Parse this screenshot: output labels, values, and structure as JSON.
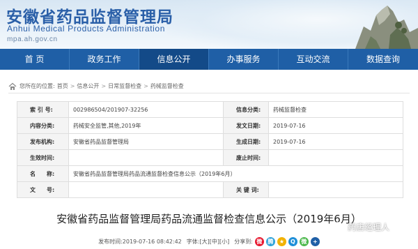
{
  "header": {
    "title": "安徽省药品监督管理局",
    "subtitle": "Anhui Medical Products Administration",
    "url": "mpa.ah.gov.cn"
  },
  "nav": {
    "items": [
      {
        "label": "首 页"
      },
      {
        "label": "政务工作"
      },
      {
        "label": "信息公开"
      },
      {
        "label": "办事服务"
      },
      {
        "label": "互动交流"
      },
      {
        "label": "数据查询"
      }
    ],
    "active_index": 2
  },
  "breadcrumb": {
    "prefix": "您所在的位置:",
    "items": [
      "首页",
      "信息公开",
      "日常监督检查",
      "药械监督检查"
    ],
    "separator": ">"
  },
  "meta": {
    "rows": [
      {
        "l1": "索 引 号:",
        "v1": "002986504/201907-32256",
        "l2": "信息分类:",
        "v2": "药械监督检查"
      },
      {
        "l1": "内容分类:",
        "v1": "药械安全监管,其他,2019年",
        "l2": "发文日期:",
        "v2": "2019-07-16"
      },
      {
        "l1": "发布机构:",
        "v1": "安徽省药品监督管理局",
        "l2": "生成日期:",
        "v2": "2019-07-16"
      },
      {
        "l1": "生效时间:",
        "v1": "",
        "l2": "废止时间:",
        "v2": ""
      }
    ],
    "name_label": "名　　称:",
    "name_value": "安徽省药品监督管理局药品流通监督检查信息公示（2019年6月）",
    "last_row": {
      "l1": "文　　号:",
      "v1": "",
      "l2": "关 键 词:",
      "v2": ""
    }
  },
  "article": {
    "title": "安徽省药品监督管理局药品流通监督检查信息公示（2019年6月）"
  },
  "watermark": {
    "text": "药店经理人"
  },
  "info": {
    "publish_label": "发布时间:",
    "publish_time": "2019-07-16 08:42:42",
    "font_label": "字体:",
    "sizes": [
      "[大]",
      "[中]",
      "[小]"
    ],
    "share_label": "分享到:"
  },
  "share_icons": [
    {
      "name": "weibo",
      "color": "#e6162d",
      "glyph": "微"
    },
    {
      "name": "tencent-weibo",
      "color": "#2fa3d9",
      "glyph": "腾"
    },
    {
      "name": "qzone",
      "color": "#f2b200",
      "glyph": "★"
    },
    {
      "name": "qq",
      "color": "#1f8fd8",
      "glyph": "Q"
    },
    {
      "name": "wechat",
      "color": "#4cb84c",
      "glyph": "微"
    },
    {
      "name": "more",
      "color": "#1f5fa6",
      "glyph": "+"
    }
  ],
  "colors": {
    "brand_blue": "#1f5fa6",
    "nav_active": "#134a88",
    "title_blue": "#2a5fa8"
  }
}
